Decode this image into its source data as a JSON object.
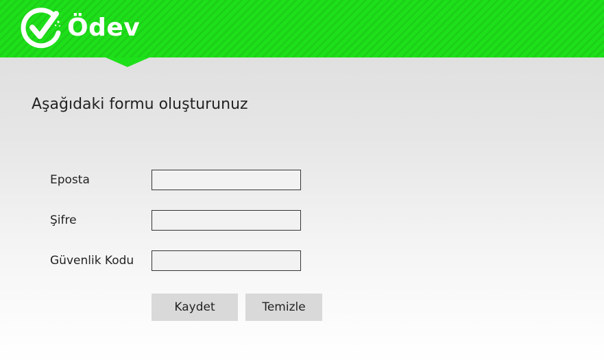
{
  "header": {
    "brand_name": "Ödev",
    "brand_color": "#1ee01a",
    "logo_icon": "checkmark-circle-icon"
  },
  "main": {
    "title": "Aşağıdaki formu oluşturunuz"
  },
  "form": {
    "fields": [
      {
        "label": "Eposta",
        "value": "",
        "placeholder": ""
      },
      {
        "label": "Şifre",
        "value": "",
        "placeholder": ""
      },
      {
        "label": "Güvenlik Kodu",
        "value": "",
        "placeholder": ""
      }
    ],
    "save_label": "Kaydet",
    "clear_label": "Temizle"
  }
}
